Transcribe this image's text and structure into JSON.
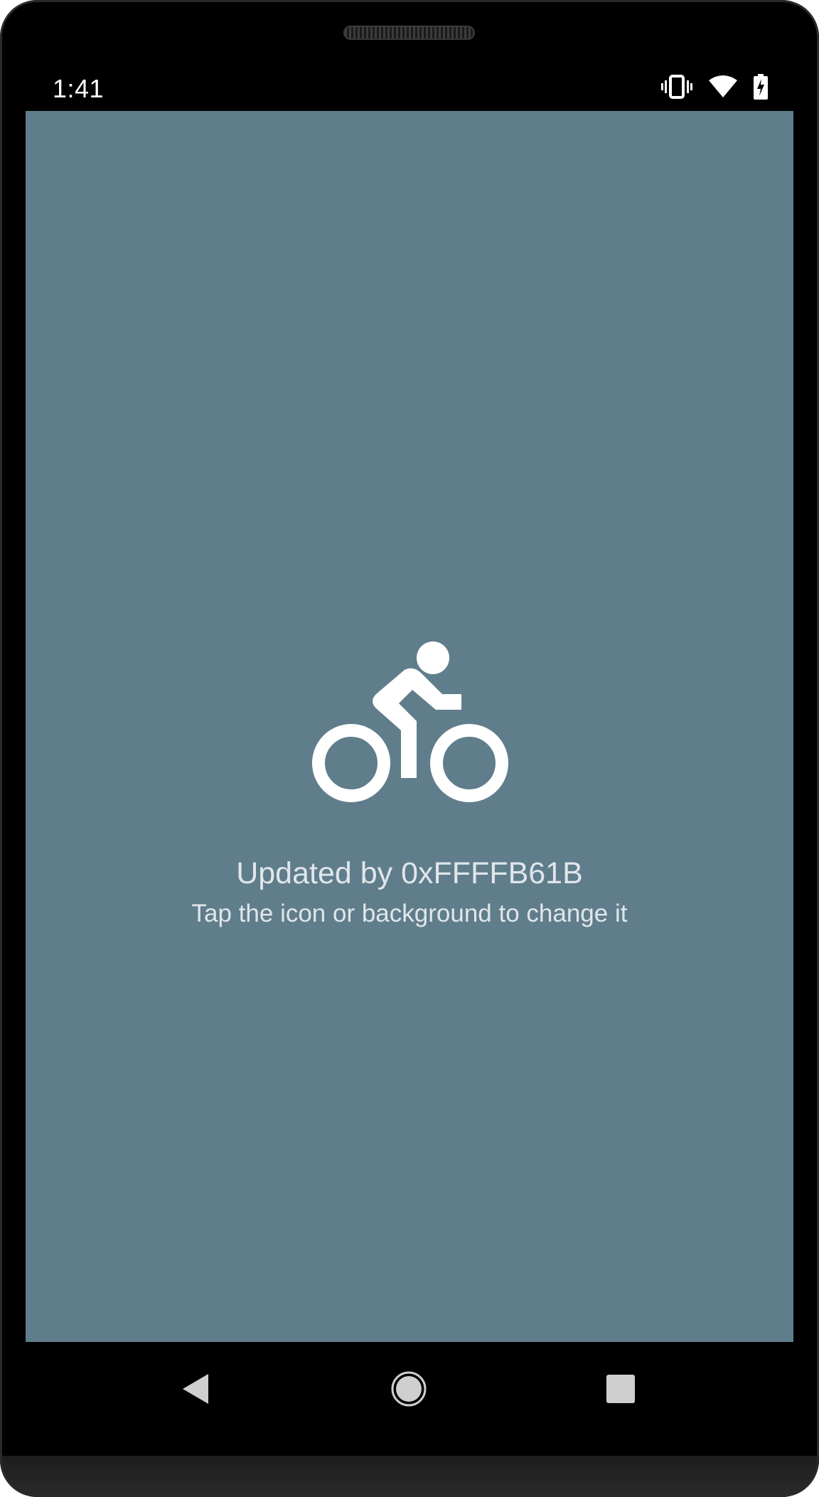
{
  "status_bar": {
    "time": "1:41",
    "icons": [
      "vibrate-icon",
      "wifi-icon",
      "battery-charging-icon"
    ]
  },
  "screen": {
    "background_color": "#607d8b",
    "icon": "bike-icon",
    "icon_color": "#ffffff",
    "title": "Updated by 0xFFFFB61B",
    "subtitle": "Tap the icon or background to change it"
  },
  "nav_bar": {
    "buttons": [
      "back-icon",
      "home-icon",
      "recents-icon"
    ]
  }
}
